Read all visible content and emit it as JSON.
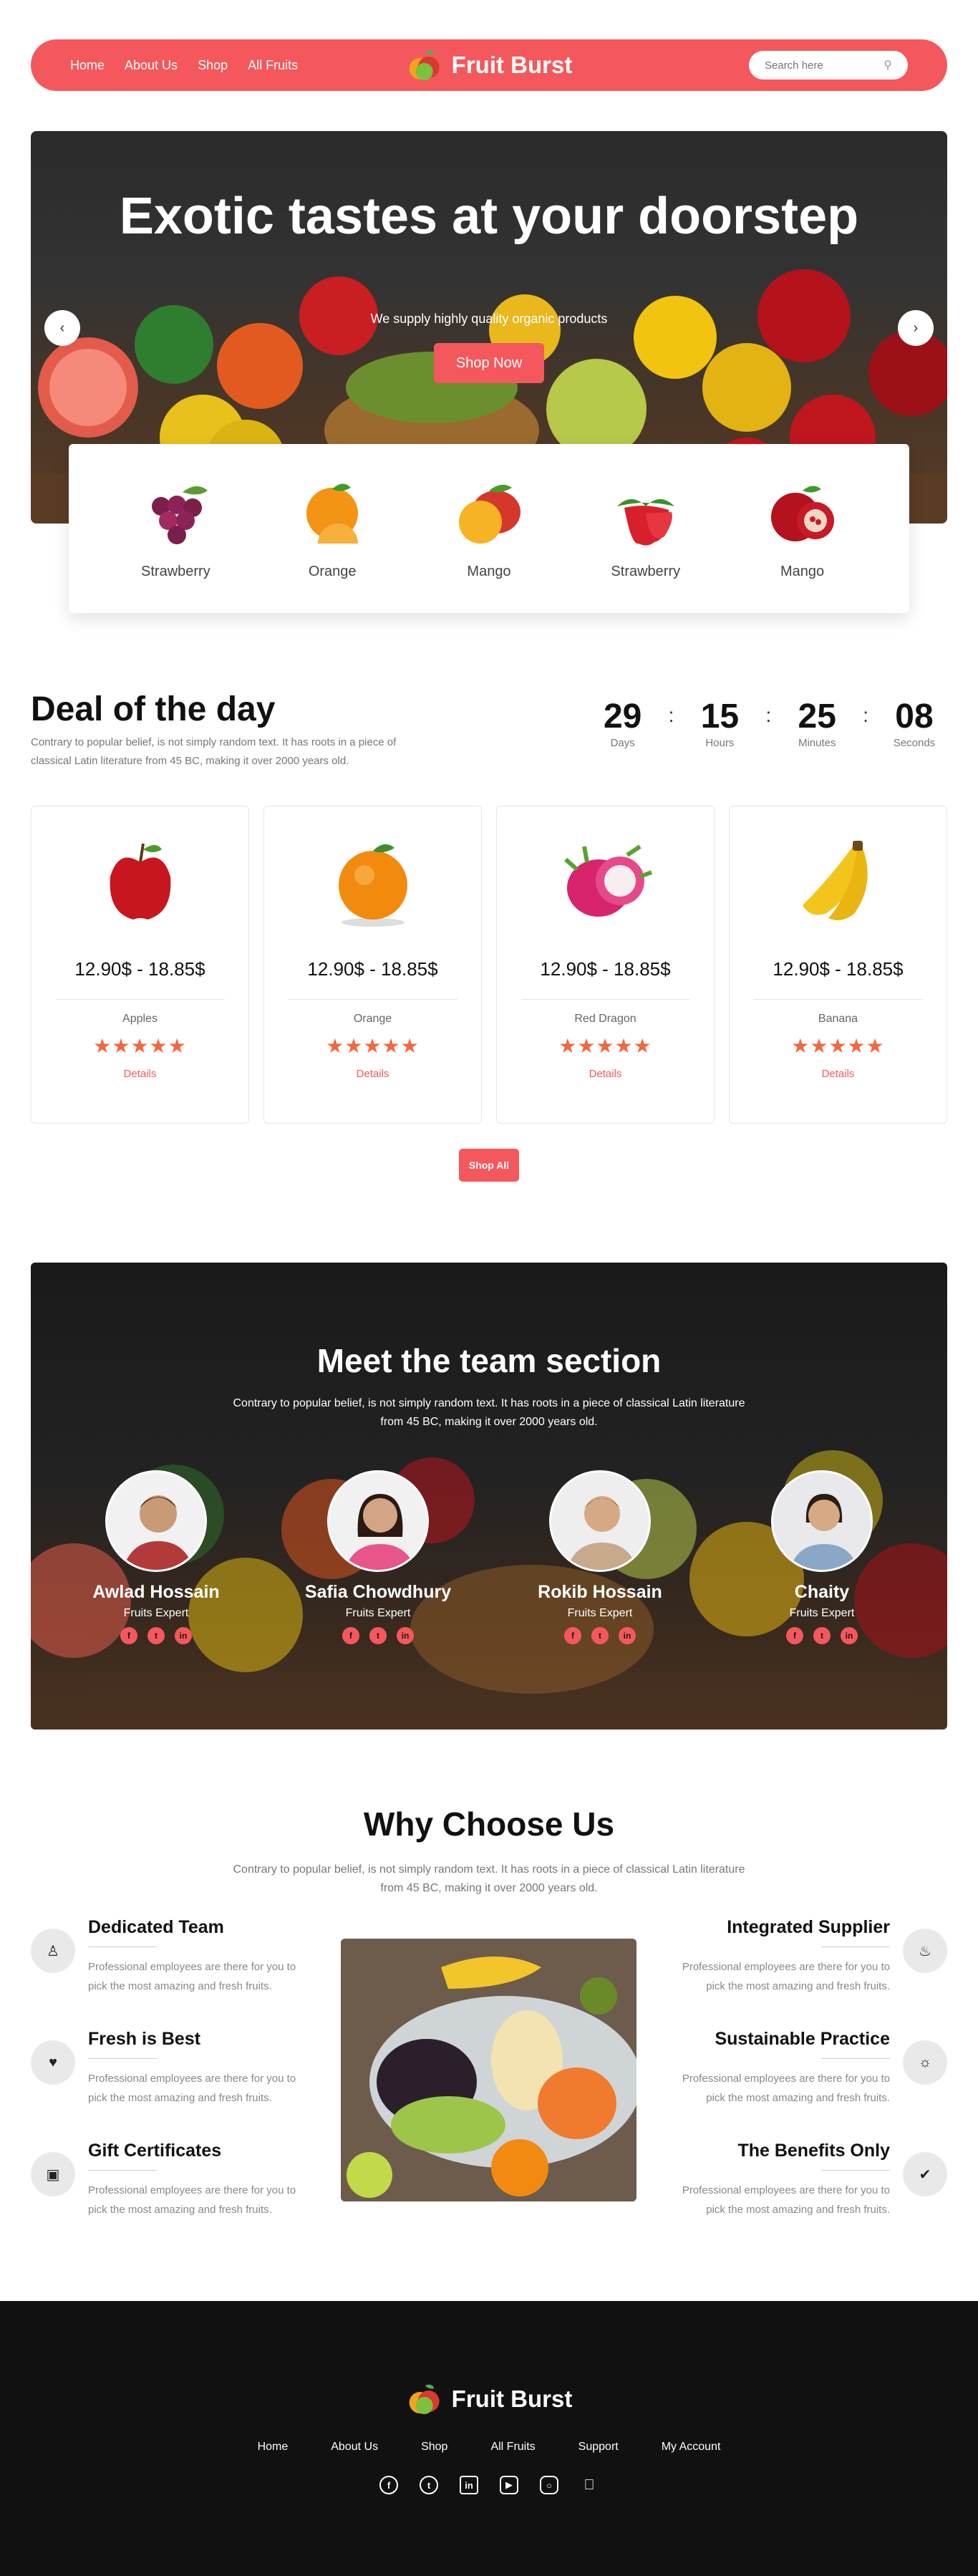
{
  "nav": {
    "links": [
      "Home",
      "About Us",
      "Shop",
      "All Fruits"
    ],
    "brand": "Fruit Burst",
    "search_placeholder": "Search here"
  },
  "hero": {
    "title": "Exotic tastes at your doorstep",
    "subtitle": "We supply highly quality organic products",
    "button": "Shop Now"
  },
  "categories": [
    "Strawberry",
    "Orange",
    "Mango",
    "Strawberry",
    "Mango"
  ],
  "deal": {
    "title": "Deal of the day",
    "description": "Contrary to popular belief, is not simply random text. It has roots in a piece of classical Latin literature from 45 BC, making it over 2000 years old.",
    "countdown": [
      {
        "value": "29",
        "label": "Days"
      },
      {
        "value": "15",
        "label": "Hours"
      },
      {
        "value": "25",
        "label": "Minutes"
      },
      {
        "value": "08",
        "label": "Seconds"
      }
    ],
    "products": [
      {
        "price": "12.90$ - 18.85$",
        "name": "Apples",
        "rating": 5,
        "link": "Details"
      },
      {
        "price": "12.90$ - 18.85$",
        "name": "Orange",
        "rating": 5,
        "link": "Details"
      },
      {
        "price": "12.90$ - 18.85$",
        "name": "Red Dragon",
        "rating": 5,
        "link": "Details"
      },
      {
        "price": "12.90$ - 18.85$",
        "name": "Banana",
        "rating": 5,
        "link": "Details"
      }
    ],
    "shop_all": "Shop All"
  },
  "team": {
    "title": "Meet the team section",
    "description": "Contrary to popular belief, is not simply random text. It has roots in a piece of classical Latin literature from 45 BC, making it over 2000 years old.",
    "members": [
      {
        "name": "Awlad Hossain",
        "role": "Fruits Expert"
      },
      {
        "name": "Safia Chowdhury",
        "role": "Fruits Expert"
      },
      {
        "name": "Rokib Hossain",
        "role": "Fruits Expert"
      },
      {
        "name": "Chaity",
        "role": "Fruits Expert"
      }
    ]
  },
  "why": {
    "title": "Why Choose Us",
    "description": "Contrary to popular belief, is not simply random text. It has roots in a piece of classical Latin literature from 45 BC, making it over 2000 years old.",
    "features_left": [
      {
        "title": "Dedicated Team",
        "text": "Professional employees are there for you to pick the most amazing and fresh fruits.",
        "icon": "team-icon"
      },
      {
        "title": "Fresh is Best",
        "text": "Professional employees are there for you to pick the most amazing and fresh fruits.",
        "icon": "heart-icon"
      },
      {
        "title": "Gift Certificates",
        "text": "Professional employees are there for you to pick the most amazing and fresh fruits.",
        "icon": "gift-icon"
      }
    ],
    "features_right": [
      {
        "title": "Integrated Supplier",
        "text": "Professional employees are there for you to pick the most amazing and fresh fruits.",
        "icon": "bell-icon"
      },
      {
        "title": "Sustainable Practice",
        "text": "Professional employees are there for you to pick the most amazing and fresh fruits.",
        "icon": "bulb-icon"
      },
      {
        "title": "The Benefits Only",
        "text": "Professional employees are there for you to pick the most amazing and fresh fruits.",
        "icon": "thumbs-up-icon"
      }
    ]
  },
  "footer": {
    "brand": "Fruit Burst",
    "links": [
      "Home",
      "About Us",
      "Shop",
      "All Fruits",
      "Support",
      "My Account"
    ],
    "socials": [
      "facebook-icon",
      "twitter-icon",
      "linkedin-icon",
      "youtube-icon",
      "instagram-icon",
      "apple-icon"
    ]
  },
  "colors": {
    "accent": "#f4585c",
    "dark": "#111111",
    "star": "#f4663e"
  }
}
